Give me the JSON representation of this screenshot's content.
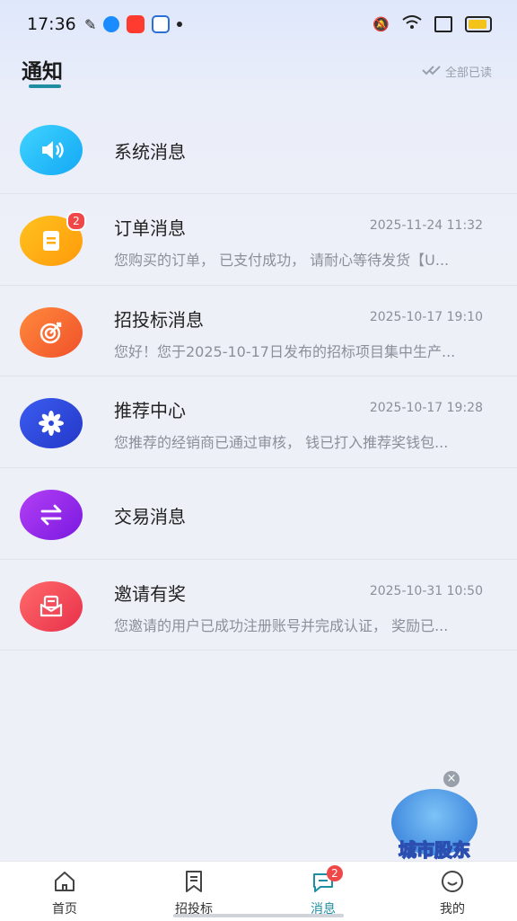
{
  "status_bar": {
    "time": "17:36"
  },
  "header": {
    "title": "通知",
    "read_all": "全部已读"
  },
  "notifications": [
    {
      "name": "系统消息",
      "time": "",
      "preview": "",
      "badge": "",
      "icon": "speaker-icon",
      "color_from": "#3fd3ff",
      "color_to": "#14a8f5"
    },
    {
      "name": "订单消息",
      "time": "2025-11-24 11:32",
      "preview": "您购买的订单， 已支付成功， 请耐心等待发货【U...",
      "badge": "2",
      "icon": "document-icon",
      "color_from": "#ffc21f",
      "color_to": "#ff9a0a"
    },
    {
      "name": "招投标消息",
      "time": "2025-10-17 19:10",
      "preview": "您好！您于2025-10-17日发布的招标项目集中生产...",
      "badge": "",
      "icon": "target-icon",
      "color_from": "#ff8a3c",
      "color_to": "#f0502a"
    },
    {
      "name": "推荐中心",
      "time": "2025-10-17 19:28",
      "preview": "您推荐的经销商已通过审核， 钱已打入推荐奖钱包...",
      "badge": "",
      "icon": "flower-icon",
      "color_from": "#3b5cf0",
      "color_to": "#2438c8"
    },
    {
      "name": "交易消息",
      "time": "",
      "preview": "",
      "badge": "",
      "icon": "exchange-icon",
      "color_from": "#b340f5",
      "color_to": "#7a18e0"
    },
    {
      "name": "邀请有奖",
      "time": "2025-10-31 10:50",
      "preview": "您邀请的用户已成功注册账号并完成认证， 奖励已...",
      "badge": "",
      "icon": "envelope-icon",
      "color_from": "#ff6a6a",
      "color_to": "#e8304a"
    }
  ],
  "promo": {
    "text": "城市股东",
    "close": "×"
  },
  "tabbar": {
    "tabs": [
      {
        "label": "首页",
        "icon": "home-icon"
      },
      {
        "label": "招投标",
        "icon": "bookmark-icon"
      },
      {
        "label": "消息",
        "icon": "message-icon",
        "badge": "2",
        "active": true
      },
      {
        "label": "我的",
        "icon": "smile-icon"
      }
    ]
  },
  "colors": {
    "accent": "#1f8ea3",
    "badge": "#f04848"
  }
}
